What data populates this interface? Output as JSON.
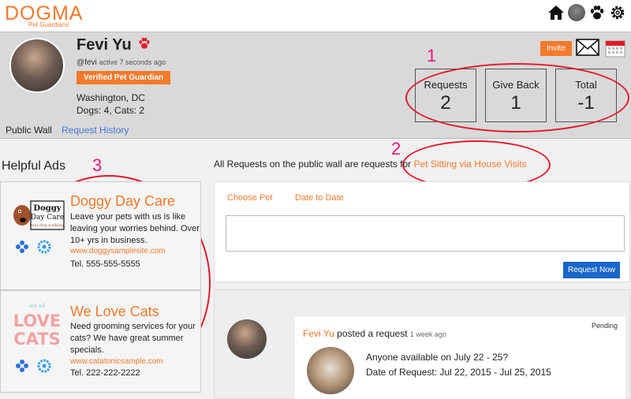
{
  "app": {
    "logo": "DOGMA",
    "logo_sub": "Pet Guardians"
  },
  "icons": {
    "home": "home-icon",
    "paw": "paw-icon",
    "gear": "gear-icon",
    "mail": "mail-icon",
    "calendar": "calendar-icon"
  },
  "profile": {
    "name": "Fevi Yu",
    "handle": "@fevi",
    "active": "active 7 seconds ago",
    "verified": "Verified Pet Guardian",
    "city": "Washington, DC",
    "pets": "Dogs: 4, Cats: 2",
    "tabs": {
      "wall": "Public Wall",
      "history": "Request History"
    },
    "invite": "Invite"
  },
  "stats": {
    "requests": {
      "label": "Requests",
      "value": "2"
    },
    "give_back": {
      "label": "Give Back",
      "value": "1"
    },
    "total": {
      "label": "Total",
      "value": "-1"
    }
  },
  "annotations": {
    "one": "1",
    "two": "2",
    "three": "3"
  },
  "ads": {
    "title": "Helpful Ads",
    "items": [
      {
        "title": "Doggy Day Care",
        "text": "Leave your pets with us is like leaving your worries behind. Over 10+ yrs in business.",
        "link": "www.doggysamplesite.com",
        "tel": "Tel. 555-555-5555",
        "logo_lines": [
          "Doggy",
          "Day Care"
        ],
        "logo_tagline": "and dog walking"
      },
      {
        "title": "We Love Cats",
        "text": "Need grooming services for your cats? We have great summer specials.",
        "link": "www.catatonicsample.com",
        "tel": "Tel. 222-222-2222",
        "logo_lines": [
          "LOVE",
          "CATS"
        ],
        "logo_small": "we all"
      }
    ]
  },
  "wall": {
    "note_prefix": "All Requests on the public wall are requests for",
    "note_highlight": "Pet Sitting via House Visits",
    "choose_pet": "Choose Pet",
    "date_to_date": "Date to Date",
    "request_button": "Request Now"
  },
  "post": {
    "user": "Fevi Yu",
    "action": "posted a request",
    "time": "1 week ago",
    "status": "Pending",
    "question": "Anyone available on July 22 - 25?",
    "date": "Date of Request: Jul 22, 2015 - Jul 25, 2015"
  },
  "colors": {
    "accent": "#f47a2c",
    "link": "#4a76d9",
    "button": "#1a66c9",
    "annotation": "#e3192b"
  }
}
